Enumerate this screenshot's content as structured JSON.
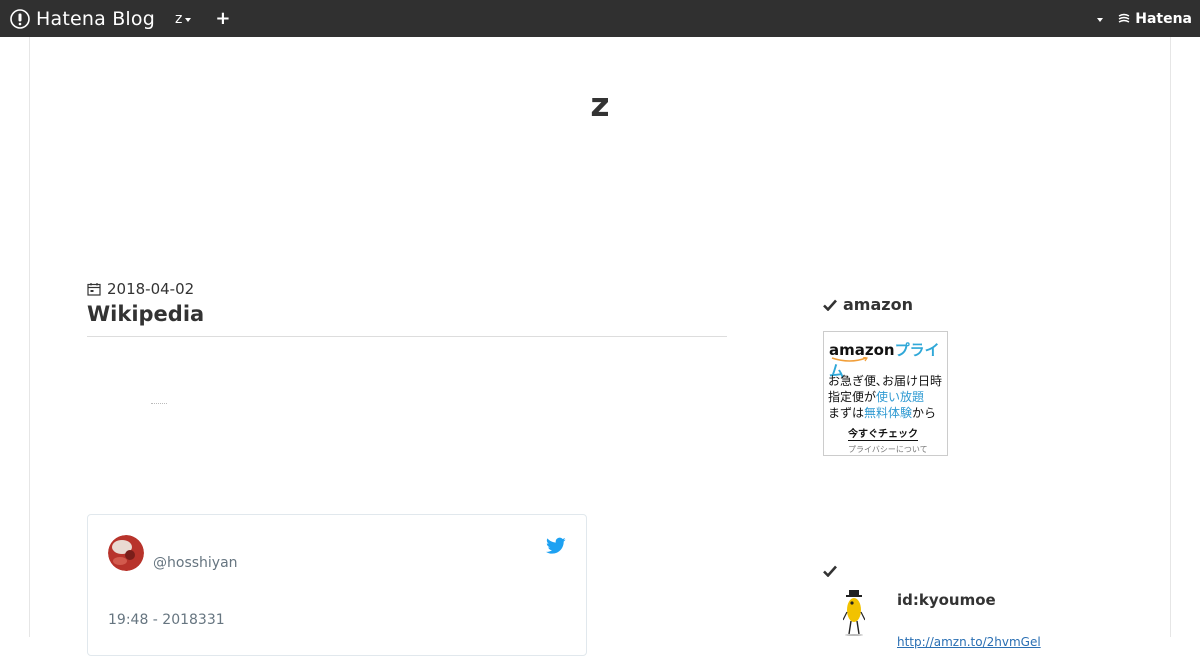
{
  "header": {
    "logo_text": "Hatena Blog",
    "blog_selector_label": "z",
    "add_label": "+",
    "hatena_label": "Hatena"
  },
  "blog": {
    "title": "z"
  },
  "entry": {
    "date": "2018-04-02",
    "title": "Wikipedia"
  },
  "tweet": {
    "handle": "@hosshiyan",
    "time": "19:48 - 2018331"
  },
  "sidebar": {
    "module1_title": "amazon",
    "ad": {
      "brand_amazon": "amazon",
      "brand_prime": "プライム",
      "line1": "お急ぎ便､お届け日時",
      "line2_a": "指定便が",
      "line2_b": "使い放題",
      "line3_a": "まずは",
      "line3_b": "無料体験",
      "line3_c": "から",
      "cta": "今すぐチェック",
      "privacy": "プライバシーについて"
    },
    "profile": {
      "id": "id:kyoumoe",
      "link": "http://amzn.to/2hvmGel"
    }
  },
  "colors": {
    "header_bg": "#303030",
    "twitter_blue": "#1da1f2",
    "link_blue": "#2a6fb3",
    "prime_blue": "#30a8d8"
  }
}
